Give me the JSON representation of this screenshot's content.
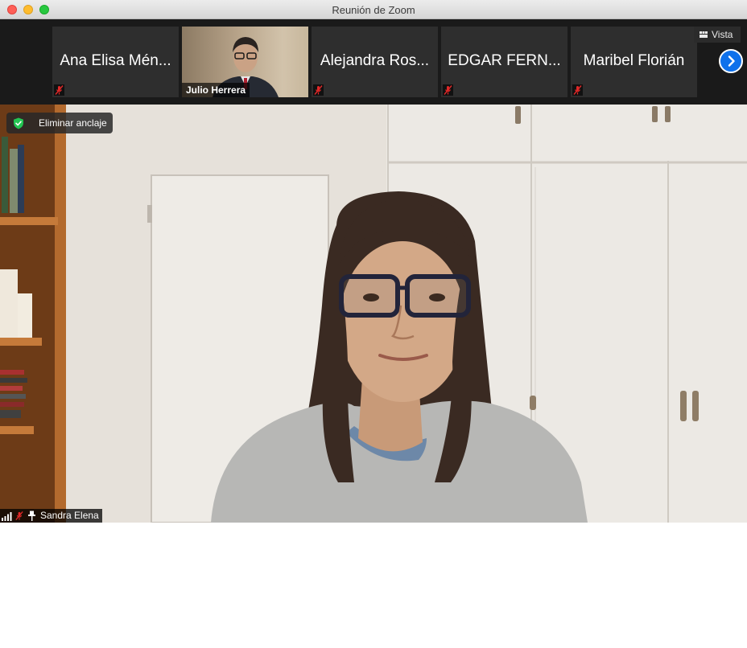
{
  "window": {
    "title": "Reunión de Zoom"
  },
  "gallery": {
    "participants": [
      {
        "name": "Ana Elisa Mén...",
        "muted": true,
        "video": false
      },
      {
        "name": "Julio Herrera",
        "muted": false,
        "video": true
      },
      {
        "name": "Alejandra Ros...",
        "muted": true,
        "video": false
      },
      {
        "name": "EDGAR FERN...",
        "muted": true,
        "video": false
      },
      {
        "name": "Maribel Florián",
        "muted": true,
        "video": false
      }
    ],
    "view_button": "Vista"
  },
  "main_video": {
    "unpin_label": "Eliminar anclaje",
    "speaker_name": "Sandra Elena",
    "speaker_muted": true,
    "speaker_pinned": true
  },
  "colors": {
    "accent": "#0e71eb",
    "strip_bg": "#1a1a1a",
    "tile_bg": "#2e2e2e",
    "mute_red": "#e02828",
    "shield_green": "#23c552"
  }
}
